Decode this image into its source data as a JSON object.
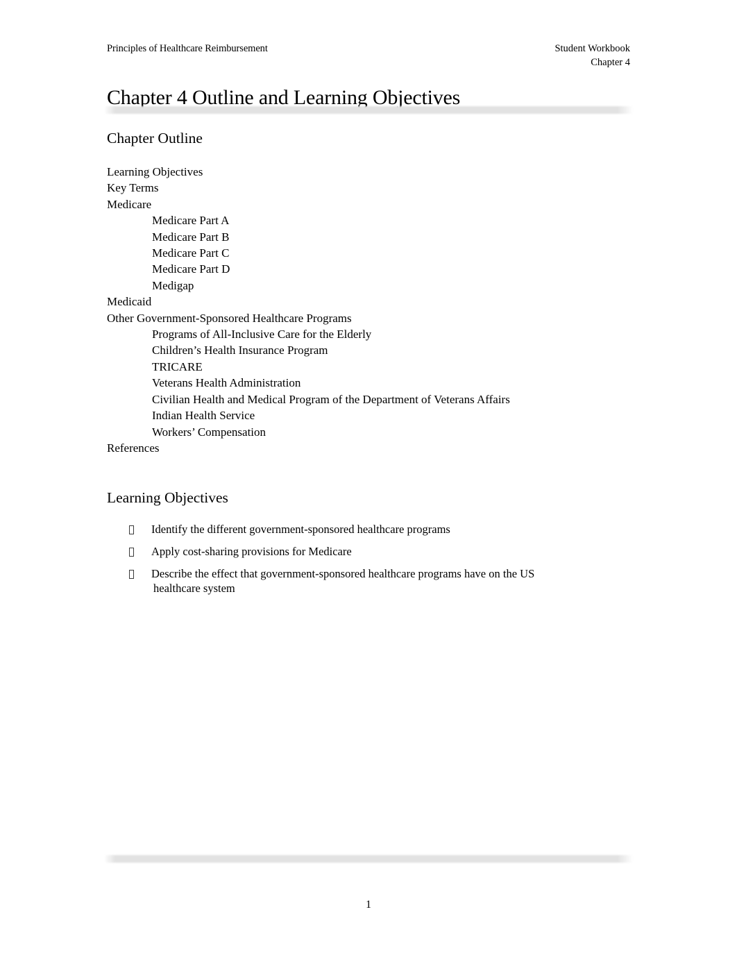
{
  "header": {
    "left": "Principles of Healthcare Reimbursement",
    "right_line1": "Student Workbook",
    "right_line2": "Chapter 4"
  },
  "title": "Chapter 4 Outline and Learning Objectives",
  "sections": {
    "outline_heading": "Chapter Outline",
    "objectives_heading": "Learning Objectives"
  },
  "outline": [
    {
      "level": 1,
      "text": "Learning Objectives"
    },
    {
      "level": 1,
      "text": "Key Terms"
    },
    {
      "level": 1,
      "text": "Medicare"
    },
    {
      "level": 2,
      "text": "Medicare Part A"
    },
    {
      "level": 2,
      "text": "Medicare Part B"
    },
    {
      "level": 2,
      "text": "Medicare Part C"
    },
    {
      "level": 2,
      "text": "Medicare Part D"
    },
    {
      "level": 2,
      "text": "Medigap"
    },
    {
      "level": 1,
      "text": "Medicaid"
    },
    {
      "level": 1,
      "text": "Other Government-Sponsored Healthcare Programs"
    },
    {
      "level": 2,
      "text": "Programs of All-Inclusive Care for the Elderly"
    },
    {
      "level": 2,
      "text": "Children’s Health Insurance Program"
    },
    {
      "level": 2,
      "text": "TRICARE"
    },
    {
      "level": 2,
      "text": "Veterans Health Administration"
    },
    {
      "level": 2,
      "text": "Civilian Health and Medical Program of the Department of Veterans Affairs"
    },
    {
      "level": 2,
      "text": "Indian Health Service"
    },
    {
      "level": 2,
      "text": "Workers’ Compensation"
    },
    {
      "level": 1,
      "text": "References"
    }
  ],
  "objectives": [
    {
      "line1": "Identify the different government-sponsored healthcare programs",
      "line2": ""
    },
    {
      "line1": "Apply cost-sharing provisions for Medicare",
      "line2": ""
    },
    {
      "line1": "Describe the effect that government-sponsored healthcare programs have on the US",
      "line2": "healthcare system"
    }
  ],
  "bullet_glyph": "missing-glyph-box",
  "footer": {
    "page_number": "1"
  },
  "colors": {
    "text": "#000000",
    "rule": "#e2e2e2",
    "background": "#ffffff"
  }
}
